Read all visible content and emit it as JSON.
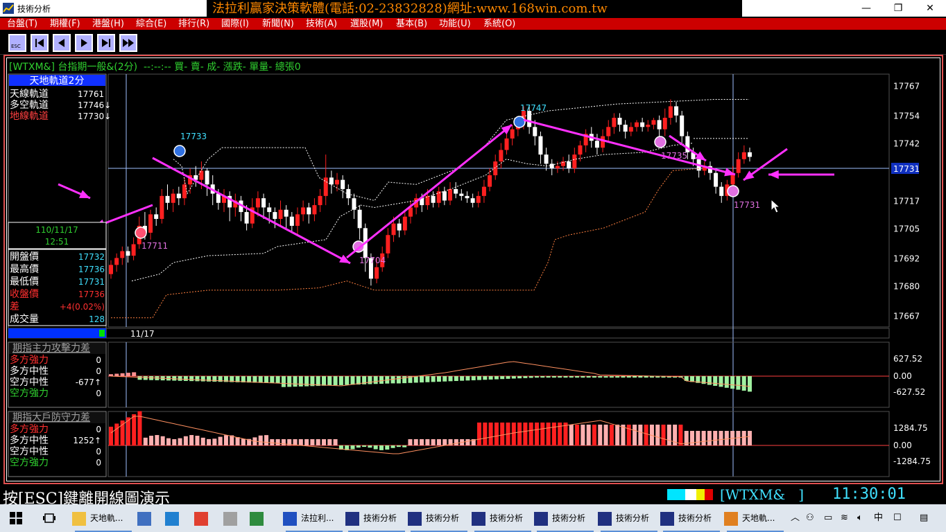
{
  "window": {
    "title": "技術分析",
    "banner": "法拉利贏家決策軟體(電話:02-23832828)網址:www.168win.com.tw",
    "controls": {
      "minimize": "—",
      "restore": "❐",
      "close": "✕"
    }
  },
  "menu": [
    "台盤(T)",
    "期權(F)",
    "港盤(H)",
    "綜合(E)",
    "排行(R)",
    "國際(I)",
    "新聞(N)",
    "技術(A)",
    "選股(M)",
    "基本(B)",
    "功能(U)",
    "系統(O)"
  ],
  "toolbar": {
    "esc_label": "ESC",
    "buttons": [
      "first",
      "prev",
      "next",
      "last",
      "fast-forward"
    ]
  },
  "chart_header": "[WTXM&] 台指期一般&(2分)  --:--:-- 買- 賣- 成- 漲跌- 單量- 總張0",
  "indicator_box": {
    "title": "天地軌道2分",
    "rows": [
      {
        "label": "天線軌道",
        "value": "17761",
        "color": "#ffffff"
      },
      {
        "label": "多空軌道",
        "value": "17746↓",
        "color": "#ffffff"
      },
      {
        "label": "地線軌道",
        "value": "17730↓",
        "color": "#ff4040"
      }
    ]
  },
  "cursor_info": {
    "date": "110/11/17",
    "time": "12:51"
  },
  "quote_box": [
    {
      "label": "開盤價",
      "value": "17732",
      "label_color": "#ffffff",
      "value_color": "#40e0ff"
    },
    {
      "label": "最高價",
      "value": "17736",
      "label_color": "#ffffff",
      "value_color": "#40e0ff"
    },
    {
      "label": "最低價",
      "value": "17731",
      "label_color": "#ffffff",
      "value_color": "#40e0ff"
    },
    {
      "label": "收盤價",
      "value": "17736",
      "label_color": "#ff3030",
      "value_color": "#ff3030"
    },
    {
      "label": "差",
      "value": "+4(0.02%)",
      "label_color": "#ff3030",
      "value_color": "#ff3030"
    },
    {
      "label": "成交量",
      "value": "128",
      "label_color": "#ffffff",
      "value_color": "#40e0ff"
    }
  ],
  "price_axis": [
    "17767",
    "17754",
    "17742",
    "17731",
    "17717",
    "17705",
    "17692",
    "17680",
    "17667"
  ],
  "current_price": "17731",
  "date_label": "11/17",
  "annotations": [
    "17733",
    "17711",
    "17704",
    "17747",
    "17735",
    "17731"
  ],
  "panel1": {
    "title": "期指主力攻擊力差",
    "rows": [
      {
        "label": "多方強力",
        "value": "0",
        "color": "#ff3030"
      },
      {
        "label": "多方中性",
        "value": "0",
        "color": "#ffffff"
      },
      {
        "label": "空方中性",
        "value": "-677↑",
        "color": "#ffffff"
      },
      {
        "label": "空方強力",
        "value": "0",
        "color": "#30d030"
      }
    ],
    "axis": [
      "627.52",
      "0.00",
      "-627.52"
    ]
  },
  "panel2": {
    "title": "期指大戶防守力差",
    "rows": [
      {
        "label": "多方強力",
        "value": "0",
        "color": "#ff3030"
      },
      {
        "label": "多方中性",
        "value": "1252↑",
        "color": "#ffffff"
      },
      {
        "label": "空方中性",
        "value": "0",
        "color": "#ffffff"
      },
      {
        "label": "空方強力",
        "value": "0",
        "color": "#30d030"
      }
    ],
    "axis": [
      "1284.75",
      "0.00",
      "-1284.75"
    ]
  },
  "status": {
    "esc_hint": "按[ESC]鍵離開線圖演示",
    "symbol": "[WTXM&   ]",
    "clock": "11:30:01"
  },
  "taskbar": {
    "items": [
      {
        "label": "天地軌...",
        "open": true
      },
      {
        "label": "",
        "open": false
      },
      {
        "label": "",
        "open": false
      },
      {
        "label": "",
        "open": false
      },
      {
        "label": "",
        "open": false
      },
      {
        "label": "",
        "open": false
      },
      {
        "label": "法拉利...",
        "open": true
      },
      {
        "label": "技術分析",
        "open": true
      },
      {
        "label": "技術分析",
        "open": true
      },
      {
        "label": "技術分析",
        "open": true
      },
      {
        "label": "技術分析",
        "open": true
      },
      {
        "label": "技術分析",
        "open": true
      },
      {
        "label": "技術分析",
        "open": true
      },
      {
        "label": "天地軌...",
        "open": true
      }
    ],
    "ime": "中"
  },
  "colors": {
    "up": "#ff2020",
    "down": "#ffffff",
    "flat": "#20ff20",
    "arrow": "#ff30ff",
    "accent": "#40e0ff"
  }
}
